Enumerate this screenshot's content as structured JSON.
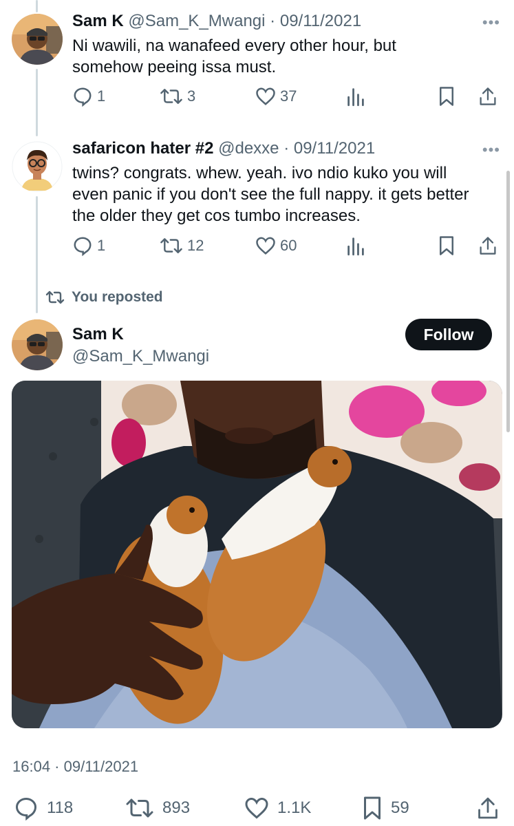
{
  "tweets": [
    {
      "name": "Sam K",
      "handle": "@Sam_K_Mwangi",
      "date": "09/11/2021",
      "text": "Ni wawili, na wanafeed every other hour, but somehow peeing issa must.",
      "replies": "1",
      "reposts": "3",
      "likes": "37",
      "avatar": "man-with-sunglasses-avatar"
    },
    {
      "name": "safaricon hater #2",
      "handle": "@dexxe",
      "date": "09/11/2021",
      "text": "twins? congrats. whew. yeah. ivo ndio kuko you will even panic if you don't see the full nappy. it gets better the older they get cos tumbo increases.",
      "replies": "1",
      "reposts": "12",
      "likes": "60",
      "avatar": "cartoon-avatar"
    }
  ],
  "repost_note": "You reposted",
  "main": {
    "name": "Sam K",
    "handle": "@Sam_K_Mwangi",
    "follow_label": "Follow",
    "photo_subject": "man-holding-two-guinea-pigs-photo",
    "timestamp": "16:04 · 09/11/2021",
    "replies": "118",
    "reposts": "893",
    "likes": "1.1K",
    "bookmarks": "59"
  },
  "dot_sep": "·",
  "more_label": "•••",
  "colors": {
    "text": "#0f1419",
    "muted": "#536471",
    "thread_line": "#cfd9de",
    "follow_bg": "#0f1419"
  },
  "icons": [
    "reply-icon",
    "repost-icon",
    "like-icon",
    "views-icon",
    "bookmark-icon",
    "share-icon",
    "more-icon"
  ]
}
